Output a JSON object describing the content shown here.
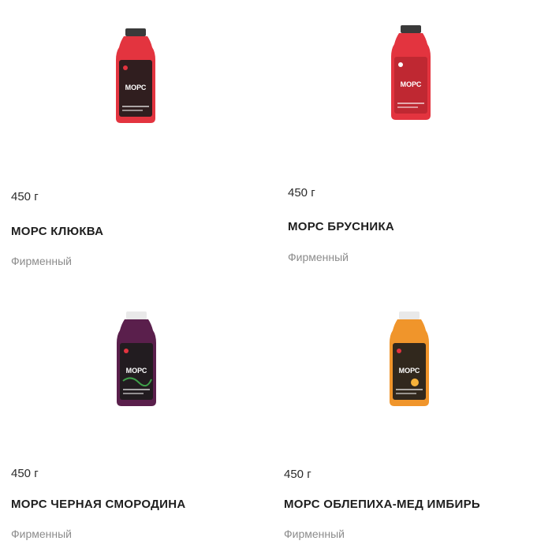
{
  "products": [
    {
      "name": "МОРС КЛЮКВА",
      "weight": "450 г",
      "category": "Фирменный",
      "liquid_color": "#e3343f",
      "cap_color": "#3a3a3a",
      "label_text": "МОРС"
    },
    {
      "name": "МОРС БРУСНИКА",
      "weight": "450 г",
      "category": "Фирменный",
      "liquid_color": "#e3343f",
      "cap_color": "#3a3a3a",
      "label_text": "МОРС"
    },
    {
      "name": "МОРС ЧЕРНАЯ СМОРОДИНА",
      "weight": "450 г",
      "category": "Фирменный",
      "liquid_color": "#5a1f4c",
      "cap_color": "#e9e9e9",
      "label_text": "МОРС"
    },
    {
      "name": "МОРС ОБЛЕПИХА-МЕД ИМБИРЬ",
      "weight": "450 г",
      "category": "Фирменный",
      "liquid_color": "#f0952b",
      "cap_color": "#e9e9e9",
      "label_text": "МОРС"
    }
  ]
}
